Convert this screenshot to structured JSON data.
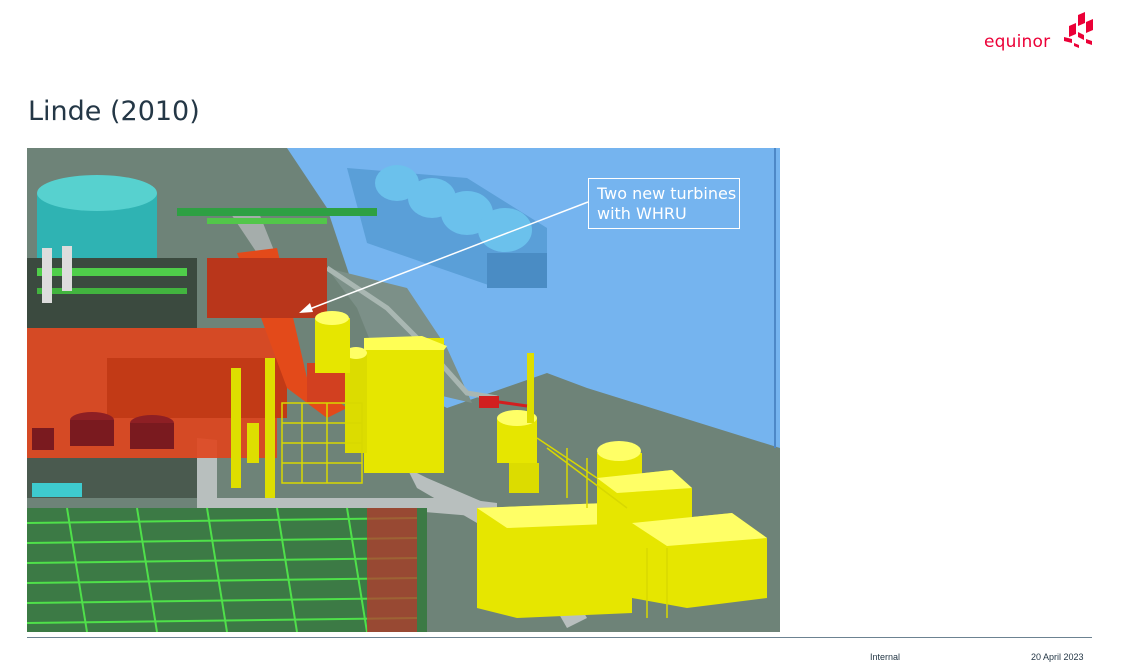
{
  "brand": {
    "name": "equinor",
    "color": "#eb0037"
  },
  "slide": {
    "title": "Linde (2010)"
  },
  "figure": {
    "image_name": "3d-plant-model",
    "callout_lines": [
      "Two new turbines",
      "with WHRU"
    ]
  },
  "footer": {
    "classification": "Internal",
    "date": "20 April 2023"
  }
}
